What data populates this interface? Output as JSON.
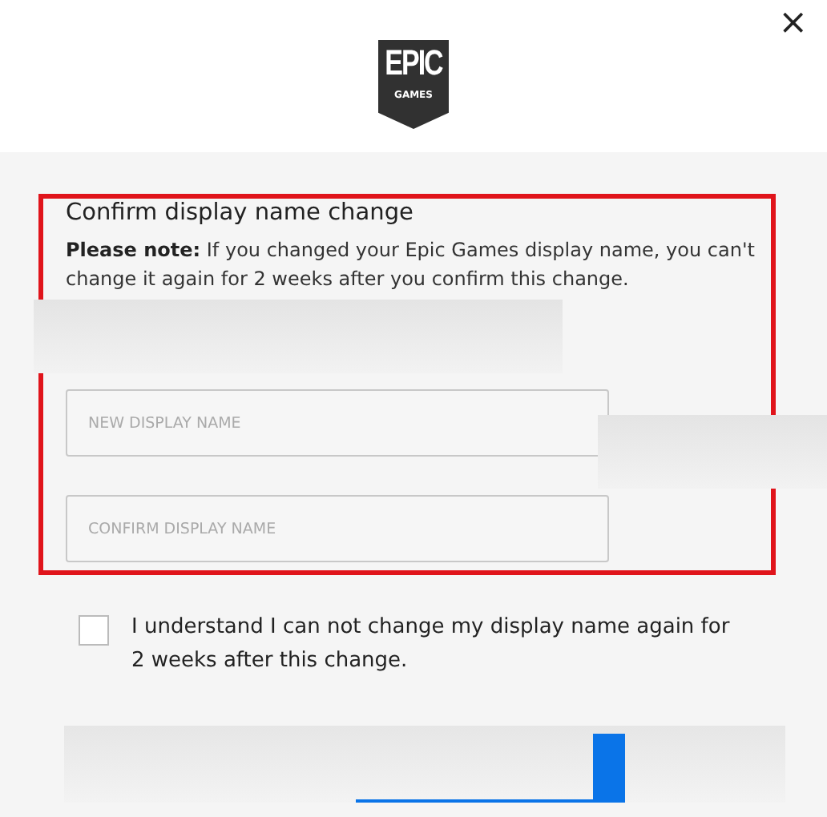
{
  "close_button": {
    "label": "×"
  },
  "logo": {
    "top": "EPIC",
    "bottom": "GAMES"
  },
  "dialog": {
    "title": "Confirm display name change",
    "note": "**Please note:** If you changed your Epic Games display name, you can't change it again for 2 weeks after you confirm this change.",
    "fields": [
      {
        "placeholder": "NEW DISPLAY NAME"
      },
      {
        "placeholder": "CONFIRM DISPLAY NAME"
      }
    ]
  },
  "agreement": {
    "checked": false,
    "label": "I understand I can not change my display name again for 2 weeks after this change."
  }
}
